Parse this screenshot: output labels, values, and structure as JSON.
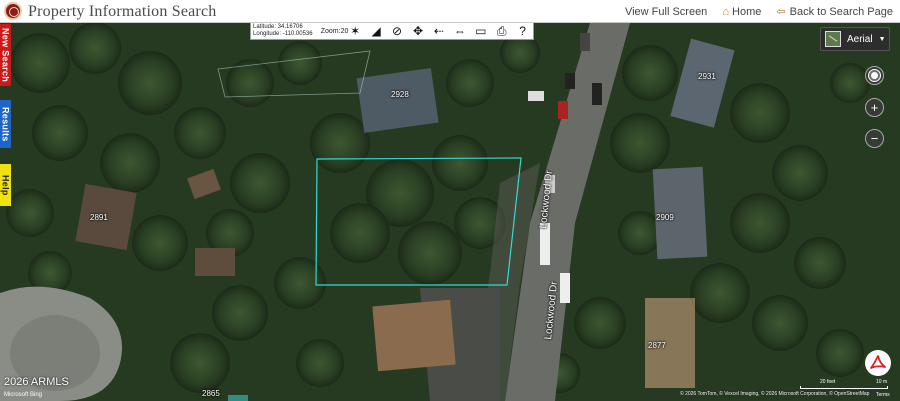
{
  "header": {
    "title": "Property Information Search",
    "links": {
      "view_full_screen": "View Full Screen",
      "home": "Home",
      "back_to_search": "Back to Search Page"
    },
    "icons": {
      "logo": "county-seal-icon",
      "home": "home-icon",
      "back": "back-arrow-icon"
    }
  },
  "side_tabs": {
    "new_search": "New Search",
    "results": "Results",
    "help": "Help"
  },
  "toolbar": {
    "latitude": "Latitude: 34.16706",
    "longitude": "Longitude: -110.00536",
    "zoom": "Zoom:20",
    "tools": [
      {
        "name": "identify-icon",
        "glyph": "✶"
      },
      {
        "name": "measure-icon",
        "glyph": "◢"
      },
      {
        "name": "no-select-icon",
        "glyph": "⊘"
      },
      {
        "name": "pan-icon",
        "glyph": "✥"
      },
      {
        "name": "previous-extent-icon",
        "glyph": "⇠"
      },
      {
        "name": "full-extent-icon",
        "glyph": "⇔"
      },
      {
        "name": "ruler-icon",
        "glyph": "▭"
      },
      {
        "name": "print-icon",
        "glyph": "⎙"
      },
      {
        "name": "help-icon",
        "glyph": "?"
      }
    ]
  },
  "map_controls": {
    "layer": "Aerial",
    "zoom_in": "+",
    "zoom_out": "−",
    "icons": {
      "layer": "layer-switcher-icon",
      "locate": "locate-icon",
      "pdf": "pdf-icon"
    }
  },
  "map": {
    "parcel_labels": [
      "2928",
      "2931",
      "2891",
      "2909",
      "2877",
      "2865"
    ],
    "street_labels": [
      "Lockwood Dr",
      "Lockwood Dr"
    ],
    "copyright": "2026 ARMLS",
    "bing": "Microsoft Bing",
    "attribution": "© 2026 TomTom, © Vexcel Imaging, © 2026 Microsoft Corporation, © OpenStreetMap",
    "scale": {
      "feet": "20 feet",
      "meters": "10 m"
    },
    "terms": "Terms"
  },
  "colors": {
    "new_search_tab": "#cc1a1a",
    "results_tab": "#1f64c9",
    "help_tab": "#f0e20f",
    "parcel_outline": "#38d8d0"
  }
}
